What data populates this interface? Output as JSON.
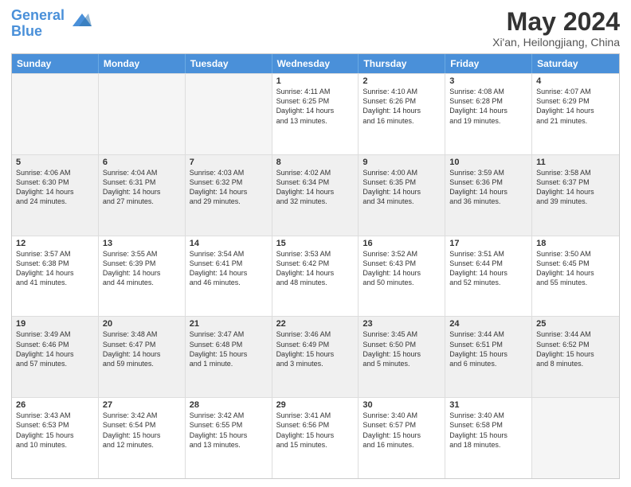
{
  "logo": {
    "line1": "General",
    "line2": "Blue"
  },
  "title": "May 2024",
  "subtitle": "Xi'an, Heilongjiang, China",
  "header_days": [
    "Sunday",
    "Monday",
    "Tuesday",
    "Wednesday",
    "Thursday",
    "Friday",
    "Saturday"
  ],
  "weeks": [
    [
      {
        "day": "",
        "info": "",
        "shaded": false,
        "empty": true
      },
      {
        "day": "",
        "info": "",
        "shaded": false,
        "empty": true
      },
      {
        "day": "",
        "info": "",
        "shaded": false,
        "empty": true
      },
      {
        "day": "1",
        "info": "Sunrise: 4:11 AM\nSunset: 6:25 PM\nDaylight: 14 hours\nand 13 minutes.",
        "shaded": false,
        "empty": false
      },
      {
        "day": "2",
        "info": "Sunrise: 4:10 AM\nSunset: 6:26 PM\nDaylight: 14 hours\nand 16 minutes.",
        "shaded": false,
        "empty": false
      },
      {
        "day": "3",
        "info": "Sunrise: 4:08 AM\nSunset: 6:28 PM\nDaylight: 14 hours\nand 19 minutes.",
        "shaded": false,
        "empty": false
      },
      {
        "day": "4",
        "info": "Sunrise: 4:07 AM\nSunset: 6:29 PM\nDaylight: 14 hours\nand 21 minutes.",
        "shaded": false,
        "empty": false
      }
    ],
    [
      {
        "day": "5",
        "info": "Sunrise: 4:06 AM\nSunset: 6:30 PM\nDaylight: 14 hours\nand 24 minutes.",
        "shaded": true,
        "empty": false
      },
      {
        "day": "6",
        "info": "Sunrise: 4:04 AM\nSunset: 6:31 PM\nDaylight: 14 hours\nand 27 minutes.",
        "shaded": true,
        "empty": false
      },
      {
        "day": "7",
        "info": "Sunrise: 4:03 AM\nSunset: 6:32 PM\nDaylight: 14 hours\nand 29 minutes.",
        "shaded": true,
        "empty": false
      },
      {
        "day": "8",
        "info": "Sunrise: 4:02 AM\nSunset: 6:34 PM\nDaylight: 14 hours\nand 32 minutes.",
        "shaded": true,
        "empty": false
      },
      {
        "day": "9",
        "info": "Sunrise: 4:00 AM\nSunset: 6:35 PM\nDaylight: 14 hours\nand 34 minutes.",
        "shaded": true,
        "empty": false
      },
      {
        "day": "10",
        "info": "Sunrise: 3:59 AM\nSunset: 6:36 PM\nDaylight: 14 hours\nand 36 minutes.",
        "shaded": true,
        "empty": false
      },
      {
        "day": "11",
        "info": "Sunrise: 3:58 AM\nSunset: 6:37 PM\nDaylight: 14 hours\nand 39 minutes.",
        "shaded": true,
        "empty": false
      }
    ],
    [
      {
        "day": "12",
        "info": "Sunrise: 3:57 AM\nSunset: 6:38 PM\nDaylight: 14 hours\nand 41 minutes.",
        "shaded": false,
        "empty": false
      },
      {
        "day": "13",
        "info": "Sunrise: 3:55 AM\nSunset: 6:39 PM\nDaylight: 14 hours\nand 44 minutes.",
        "shaded": false,
        "empty": false
      },
      {
        "day": "14",
        "info": "Sunrise: 3:54 AM\nSunset: 6:41 PM\nDaylight: 14 hours\nand 46 minutes.",
        "shaded": false,
        "empty": false
      },
      {
        "day": "15",
        "info": "Sunrise: 3:53 AM\nSunset: 6:42 PM\nDaylight: 14 hours\nand 48 minutes.",
        "shaded": false,
        "empty": false
      },
      {
        "day": "16",
        "info": "Sunrise: 3:52 AM\nSunset: 6:43 PM\nDaylight: 14 hours\nand 50 minutes.",
        "shaded": false,
        "empty": false
      },
      {
        "day": "17",
        "info": "Sunrise: 3:51 AM\nSunset: 6:44 PM\nDaylight: 14 hours\nand 52 minutes.",
        "shaded": false,
        "empty": false
      },
      {
        "day": "18",
        "info": "Sunrise: 3:50 AM\nSunset: 6:45 PM\nDaylight: 14 hours\nand 55 minutes.",
        "shaded": false,
        "empty": false
      }
    ],
    [
      {
        "day": "19",
        "info": "Sunrise: 3:49 AM\nSunset: 6:46 PM\nDaylight: 14 hours\nand 57 minutes.",
        "shaded": true,
        "empty": false
      },
      {
        "day": "20",
        "info": "Sunrise: 3:48 AM\nSunset: 6:47 PM\nDaylight: 14 hours\nand 59 minutes.",
        "shaded": true,
        "empty": false
      },
      {
        "day": "21",
        "info": "Sunrise: 3:47 AM\nSunset: 6:48 PM\nDaylight: 15 hours\nand 1 minute.",
        "shaded": true,
        "empty": false
      },
      {
        "day": "22",
        "info": "Sunrise: 3:46 AM\nSunset: 6:49 PM\nDaylight: 15 hours\nand 3 minutes.",
        "shaded": true,
        "empty": false
      },
      {
        "day": "23",
        "info": "Sunrise: 3:45 AM\nSunset: 6:50 PM\nDaylight: 15 hours\nand 5 minutes.",
        "shaded": true,
        "empty": false
      },
      {
        "day": "24",
        "info": "Sunrise: 3:44 AM\nSunset: 6:51 PM\nDaylight: 15 hours\nand 6 minutes.",
        "shaded": true,
        "empty": false
      },
      {
        "day": "25",
        "info": "Sunrise: 3:44 AM\nSunset: 6:52 PM\nDaylight: 15 hours\nand 8 minutes.",
        "shaded": true,
        "empty": false
      }
    ],
    [
      {
        "day": "26",
        "info": "Sunrise: 3:43 AM\nSunset: 6:53 PM\nDaylight: 15 hours\nand 10 minutes.",
        "shaded": false,
        "empty": false
      },
      {
        "day": "27",
        "info": "Sunrise: 3:42 AM\nSunset: 6:54 PM\nDaylight: 15 hours\nand 12 minutes.",
        "shaded": false,
        "empty": false
      },
      {
        "day": "28",
        "info": "Sunrise: 3:42 AM\nSunset: 6:55 PM\nDaylight: 15 hours\nand 13 minutes.",
        "shaded": false,
        "empty": false
      },
      {
        "day": "29",
        "info": "Sunrise: 3:41 AM\nSunset: 6:56 PM\nDaylight: 15 hours\nand 15 minutes.",
        "shaded": false,
        "empty": false
      },
      {
        "day": "30",
        "info": "Sunrise: 3:40 AM\nSunset: 6:57 PM\nDaylight: 15 hours\nand 16 minutes.",
        "shaded": false,
        "empty": false
      },
      {
        "day": "31",
        "info": "Sunrise: 3:40 AM\nSunset: 6:58 PM\nDaylight: 15 hours\nand 18 minutes.",
        "shaded": false,
        "empty": false
      },
      {
        "day": "",
        "info": "",
        "shaded": false,
        "empty": true
      }
    ]
  ]
}
